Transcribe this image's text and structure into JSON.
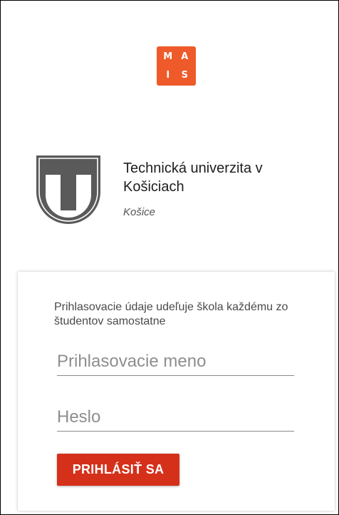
{
  "app_logo": {
    "letters": [
      "M",
      "A",
      "I",
      "S"
    ],
    "color": "#ef5a2a"
  },
  "university": {
    "name": "Technická univerzita v Košiciach",
    "city": "Košice",
    "emblem_icon": "tuke-emblem-icon"
  },
  "login": {
    "hint": "Prihlasovacie údaje udeľuje škola každému zo študentov samostatne",
    "username_placeholder": "Prihlasovacie meno",
    "username_value": "",
    "password_placeholder": "Heslo",
    "password_value": "",
    "submit_label": "PRIHLÁSIŤ SA",
    "submit_color": "#d5301a"
  }
}
